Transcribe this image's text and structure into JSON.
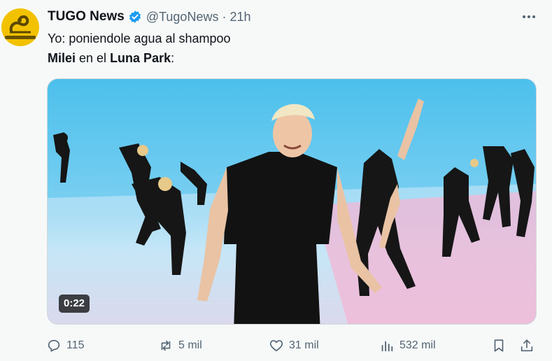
{
  "tweet": {
    "display_name": "TUGO News",
    "handle": "@TugoNews",
    "separator": "·",
    "time": "21h",
    "avatar_icon": "gadsden-snake-logo",
    "line1": "Yo: poniendole agua al shampoo",
    "line2": {
      "part1": "Milei",
      "part2": " en el ",
      "part3": "Luna Park",
      "part4": ":"
    },
    "video": {
      "duration": "0:22"
    },
    "actions": {
      "replies": "115",
      "reposts": "5 mil",
      "likes": "31 mil",
      "views": "532 mil"
    }
  },
  "colors": {
    "verified_blue": "#1d9bf0",
    "muted_text": "#536471",
    "avatar_yellow": "#f2c200"
  }
}
